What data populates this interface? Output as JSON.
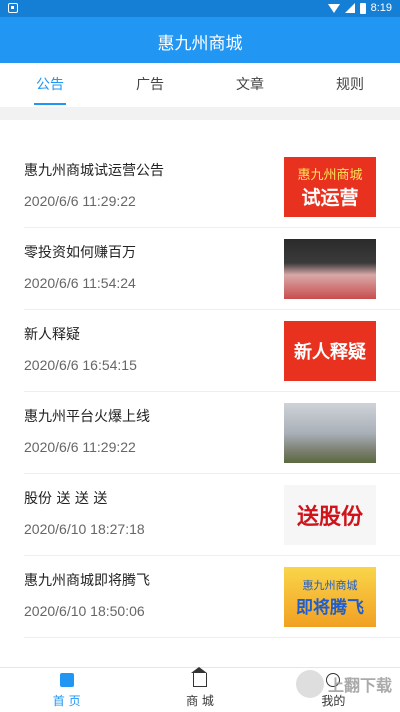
{
  "status_bar": {
    "time": "8:19"
  },
  "header": {
    "title": "惠九州商城"
  },
  "tabs": [
    {
      "label": "公告",
      "active": true
    },
    {
      "label": "广告",
      "active": false
    },
    {
      "label": "文章",
      "active": false
    },
    {
      "label": "规则",
      "active": false
    }
  ],
  "items": [
    {
      "title": "惠九州商城试运营公告",
      "time": "2020/6/6 11:29:22",
      "thumb": {
        "line1": "惠九州商城",
        "line2": "试运营"
      }
    },
    {
      "title": "零投资如何赚百万",
      "time": "2020/6/6 11:54:24",
      "thumb": {
        "description": "photo"
      }
    },
    {
      "title": "新人释疑",
      "time": "2020/6/6 16:54:15",
      "thumb": {
        "line1": "新人释疑"
      }
    },
    {
      "title": "惠九州平台火爆上线",
      "time": "2020/6/6 11:29:22",
      "thumb": {
        "description": "photo"
      }
    },
    {
      "title": "股份 送 送 送",
      "time": "2020/6/10 18:27:18",
      "thumb": {
        "line1": "送股份"
      }
    },
    {
      "title": "惠九州商城即将腾飞",
      "time": "2020/6/10 18:50:06",
      "thumb": {
        "line1": "惠九州商城",
        "line2": "即将腾飞"
      }
    }
  ],
  "bottom_nav": [
    {
      "label": "首 页",
      "icon": "home-icon",
      "active": true
    },
    {
      "label": "商 城",
      "icon": "shop-icon",
      "active": false
    },
    {
      "label": "我的",
      "icon": "profile-icon",
      "active": false
    }
  ],
  "watermark": {
    "text": "上翻下载"
  },
  "colors": {
    "primary": "#2296f3",
    "statusbar": "#157fd6"
  }
}
